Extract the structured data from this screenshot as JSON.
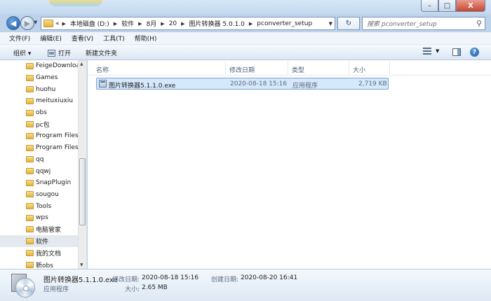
{
  "titlebar": {
    "faded_text_1": "",
    "faded_text_2": "",
    "minimize": "–",
    "maximize": "□",
    "close": "X"
  },
  "address": {
    "overflow": "«",
    "crumbs": [
      "本地磁盘 (D:)",
      "软件",
      "8月",
      "20",
      "图片转换器 5.0.1.0",
      "pconverter_setup"
    ],
    "search_placeholder": "搜索 pconverter_setup"
  },
  "menu": [
    "文件(F)",
    "编辑(E)",
    "查看(V)",
    "工具(T)",
    "帮助(H)"
  ],
  "toolbar": {
    "organize": "组织 ▾",
    "open": "打开",
    "new_folder": "新建文件夹"
  },
  "sidebar": {
    "items": [
      {
        "label": "FeigeDownloa",
        "selected": false
      },
      {
        "label": "Games",
        "selected": false
      },
      {
        "label": "huohu",
        "selected": false
      },
      {
        "label": "meituxiuxiu",
        "selected": false
      },
      {
        "label": "obs",
        "selected": false
      },
      {
        "label": "pc包",
        "selected": false
      },
      {
        "label": "Program Files",
        "selected": false
      },
      {
        "label": "Program Files",
        "selected": false
      },
      {
        "label": "qq",
        "selected": false
      },
      {
        "label": "qqwj",
        "selected": false
      },
      {
        "label": "SnapPlugin",
        "selected": false
      },
      {
        "label": "sougou",
        "selected": false
      },
      {
        "label": "Tools",
        "selected": false
      },
      {
        "label": "wps",
        "selected": false
      },
      {
        "label": "电脑管家",
        "selected": false
      },
      {
        "label": "软件",
        "selected": true
      },
      {
        "label": "我的文档",
        "selected": false
      },
      {
        "label": "新obs",
        "selected": false
      }
    ]
  },
  "columns": {
    "name": "名称",
    "modified": "修改日期",
    "type": "类型",
    "size": "大小"
  },
  "files": [
    {
      "name": "图片转换器5.1.1.0.exe",
      "modified": "2020-08-18 15:16",
      "type": "应用程序",
      "size": "2,719 KB"
    }
  ],
  "details": {
    "filename": "图片转换器5.1.1.0.exe",
    "filetype": "应用程序",
    "modified_label": "修改日期:",
    "modified_value": "2020-08-18 15:16",
    "size_label": "大小:",
    "size_value": "2.65 MB",
    "created_label": "创建日期:",
    "created_value": "2020-08-20 16:41"
  }
}
